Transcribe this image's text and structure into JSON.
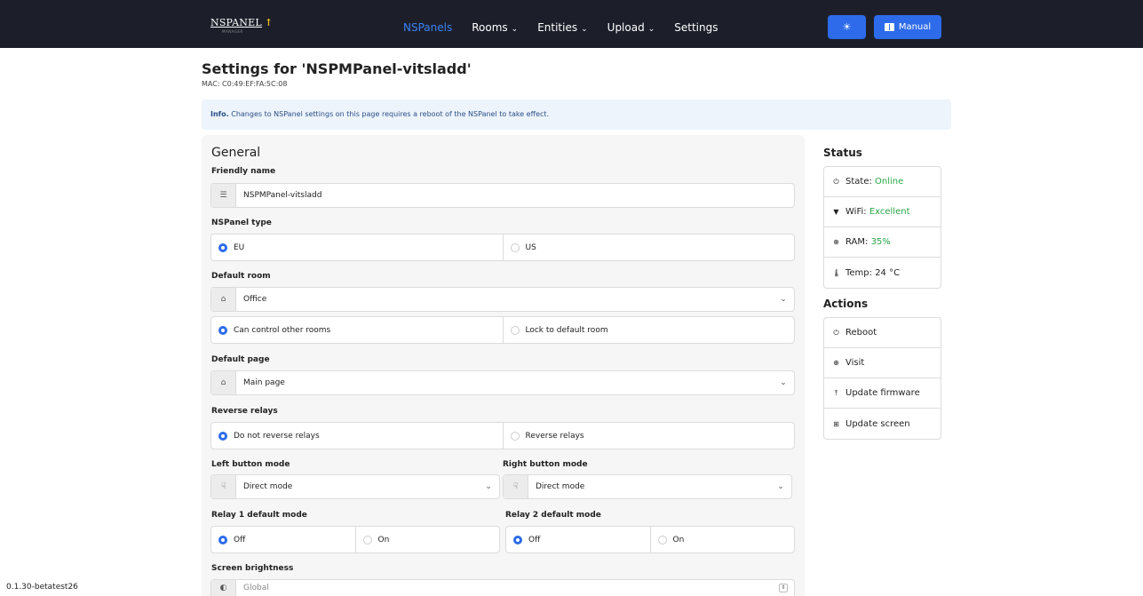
{
  "nav": {
    "brand": "NSPANEL",
    "brand_sub": "MANAGER",
    "items": [
      {
        "label": "NSPanels",
        "caret": ""
      },
      {
        "label": "Rooms",
        "caret": "⌄"
      },
      {
        "label": "Entities",
        "caret": "⌄"
      },
      {
        "label": "Upload",
        "caret": "⌄"
      },
      {
        "label": "Settings",
        "caret": ""
      }
    ],
    "manual_label": "Manual"
  },
  "header": {
    "title": "Settings for 'NSPMPanel-vitsladd'",
    "mac": "MAC: C0:49:EF:FA:5C:08"
  },
  "info": {
    "bold": "Info.",
    "text": " Changes to NSPanel settings on this page requires a reboot of the NSPanel to take effect."
  },
  "general": {
    "title": "General",
    "friendly_name_label": "Friendly name",
    "friendly_name_value": "NSPMPanel-vitsladd",
    "type_label": "NSPanel type",
    "type_options": [
      "EU",
      "US"
    ],
    "default_room_label": "Default room",
    "default_room_value": "Office",
    "room_control_options": [
      "Can control other rooms",
      "Lock to default room"
    ],
    "default_page_label": "Default page",
    "default_page_value": "Main page",
    "reverse_relays_label": "Reverse relays",
    "reverse_relays_options": [
      "Do not reverse relays",
      "Reverse relays"
    ],
    "left_button_label": "Left button mode",
    "left_button_value": "Direct mode",
    "right_button_label": "Right button mode",
    "right_button_value": "Direct mode",
    "relay1_label": "Relay 1 default mode",
    "relay1_options": [
      "Off",
      "On"
    ],
    "relay2_label": "Relay 2 default mode",
    "relay2_options": [
      "Off",
      "On"
    ],
    "brightness_label": "Screen brightness",
    "brightness_value": "Global"
  },
  "status": {
    "title": "Status",
    "state_label": "State:",
    "state_value": "Online",
    "wifi_label": "WiFi:",
    "wifi_value": "Excellent",
    "ram_label": "RAM:",
    "ram_value": "35%",
    "temp_label": "Temp: 24 °C"
  },
  "actions": {
    "title": "Actions",
    "items": [
      "Reboot",
      "Visit",
      "Update firmware",
      "Update screen"
    ]
  },
  "version": "0.1.30-betatest26",
  "colors": {
    "navbar": "#1c1f2a",
    "primary": "#2d6bea",
    "success": "#28a745",
    "info_bg": "#edf4fc"
  }
}
